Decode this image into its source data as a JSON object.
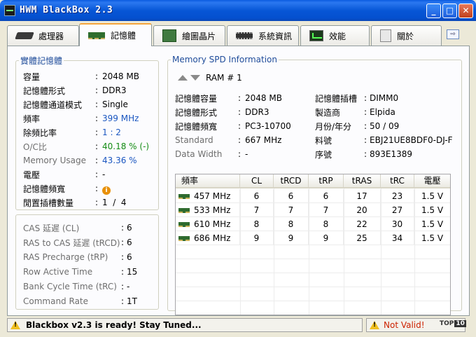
{
  "window": {
    "title": "HWM BlackBox 2.3",
    "minimize": "_",
    "maximize": "□",
    "close": "✕"
  },
  "tabs": [
    {
      "label": "處理器",
      "icon": "cpu-icon"
    },
    {
      "label": "記憶體",
      "icon": "memory-icon"
    },
    {
      "label": "繪圖晶片",
      "icon": "graphics-card-icon"
    },
    {
      "label": "系統資訊",
      "icon": "chip-icon"
    },
    {
      "label": "效能",
      "icon": "performance-icon"
    },
    {
      "label": "關於",
      "icon": "about-icon"
    }
  ],
  "physical_memory": {
    "title": "實體記憶體",
    "rows": [
      {
        "label": "容量",
        "value": "2048 MB"
      },
      {
        "label": "記憶體形式",
        "value": "DDR3"
      },
      {
        "label": "記憶體通道模式",
        "value": "Single"
      },
      {
        "label": "頻率",
        "value": "399 MHz"
      },
      {
        "label": "除頻比率",
        "value": "1 : 2"
      },
      {
        "label": "O/C比",
        "value": "40.18 % (-)"
      },
      {
        "label": "Memory Usage",
        "value": "43.36 %"
      },
      {
        "label": "電壓",
        "value": "-"
      },
      {
        "label": "記憶體頻寬",
        "value": ""
      },
      {
        "label": "閒置插槽數量",
        "value": "1  /  4"
      }
    ]
  },
  "timings": {
    "rows": [
      {
        "label": "CAS 延遲 (CL)",
        "value": "6"
      },
      {
        "label": "RAS to CAS 延遲 (tRCD)",
        "value": "6"
      },
      {
        "label": "RAS Precharge (tRP)",
        "value": "6"
      },
      {
        "label": "Row Active Time",
        "value": "15"
      },
      {
        "label": "Bank Cycle Time (tRC)",
        "value": "-"
      },
      {
        "label": "Command Rate",
        "value": "1T"
      }
    ]
  },
  "spd": {
    "title": "Memory SPD Information",
    "ram_label": "RAM # 1",
    "left": [
      {
        "label": "記憶體容量",
        "value": "2048 MB"
      },
      {
        "label": "記憶體形式",
        "value": "DDR3"
      },
      {
        "label": "記憶體頻寬",
        "value": "PC3-10700"
      },
      {
        "label": "Standard",
        "value": "667 MHz"
      },
      {
        "label": "Data Width",
        "value": "-"
      }
    ],
    "right": [
      {
        "label": "記憶體插槽",
        "value": "DIMM0"
      },
      {
        "label": "製造商",
        "value": "Elpida"
      },
      {
        "label": "月份/年分",
        "value": "50 / 09"
      },
      {
        "label": "料號",
        "value": "EBJ21UE8BDF0-DJ-F"
      },
      {
        "label": "序號",
        "value": "893E1389"
      }
    ],
    "table": {
      "headers": [
        "頻率",
        "CL",
        "tRCD",
        "tRP",
        "tRAS",
        "tRC",
        "電壓"
      ],
      "rows": [
        [
          "457 MHz",
          "6",
          "6",
          "6",
          "17",
          "23",
          "1.5 V"
        ],
        [
          "533 MHz",
          "7",
          "7",
          "7",
          "20",
          "27",
          "1.5 V"
        ],
        [
          "610 MHz",
          "8",
          "8",
          "8",
          "22",
          "30",
          "1.5 V"
        ],
        [
          "686 MHz",
          "9",
          "9",
          "9",
          "25",
          "34",
          "1.5 V"
        ]
      ]
    }
  },
  "status": {
    "message": "Blackbox v2.3 is ready! Stay Tuned...",
    "validity": "Not Valid!",
    "badge_text": "TOP",
    "badge_number": "10"
  }
}
